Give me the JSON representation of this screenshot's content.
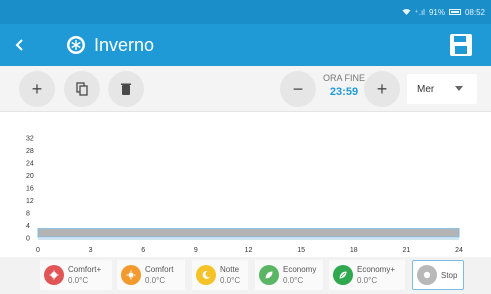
{
  "status_bar": {
    "signal_text": "⁺.ıl",
    "battery_percent": "91%",
    "time": "08:52"
  },
  "app_bar": {
    "title": "Inverno",
    "back_icon": "chevron-left-icon",
    "title_icon": "snowflake-badge-icon",
    "save_icon": "floppy-disk-icon"
  },
  "toolbar": {
    "add_symbol": "+",
    "end_time_label": "ORA FINE",
    "end_time_value": "23:59",
    "minus_symbol": "−",
    "plus_symbol": "+",
    "day_selected": "Mer"
  },
  "chart_data": {
    "type": "bar",
    "x": [
      0,
      24
    ],
    "xticks": [
      "0",
      "3",
      "6",
      "9",
      "12",
      "15",
      "18",
      "21",
      "24"
    ],
    "yticks": [
      "0",
      "4",
      "8",
      "12",
      "16",
      "20",
      "24",
      "28",
      "32"
    ],
    "ylim": [
      0,
      32
    ],
    "xlim": [
      0,
      24
    ],
    "series": [
      {
        "start": 0,
        "end": 24,
        "value": 3,
        "color": "#b4b4b4",
        "outline": "#7fbce0"
      }
    ]
  },
  "legend": [
    {
      "name": "Comfort+",
      "temp": "0.0°C",
      "color": "#e05555",
      "icon": "sun-plus-icon"
    },
    {
      "name": "Comfort",
      "temp": "0.0°C",
      "color": "#f29a2e",
      "icon": "sun-icon"
    },
    {
      "name": "Notte",
      "temp": "0.0°C",
      "color": "#f5c227",
      "icon": "moon-icon"
    },
    {
      "name": "Economy",
      "temp": "0.0°C",
      "color": "#5ab565",
      "icon": "leaf-icon"
    },
    {
      "name": "Economy+",
      "temp": "0.0°C",
      "color": "#2fa84f",
      "icon": "leaf-plus-icon"
    },
    {
      "name": "Stop",
      "temp": "",
      "color": "#b8b8b8",
      "icon": "stop-icon"
    }
  ]
}
